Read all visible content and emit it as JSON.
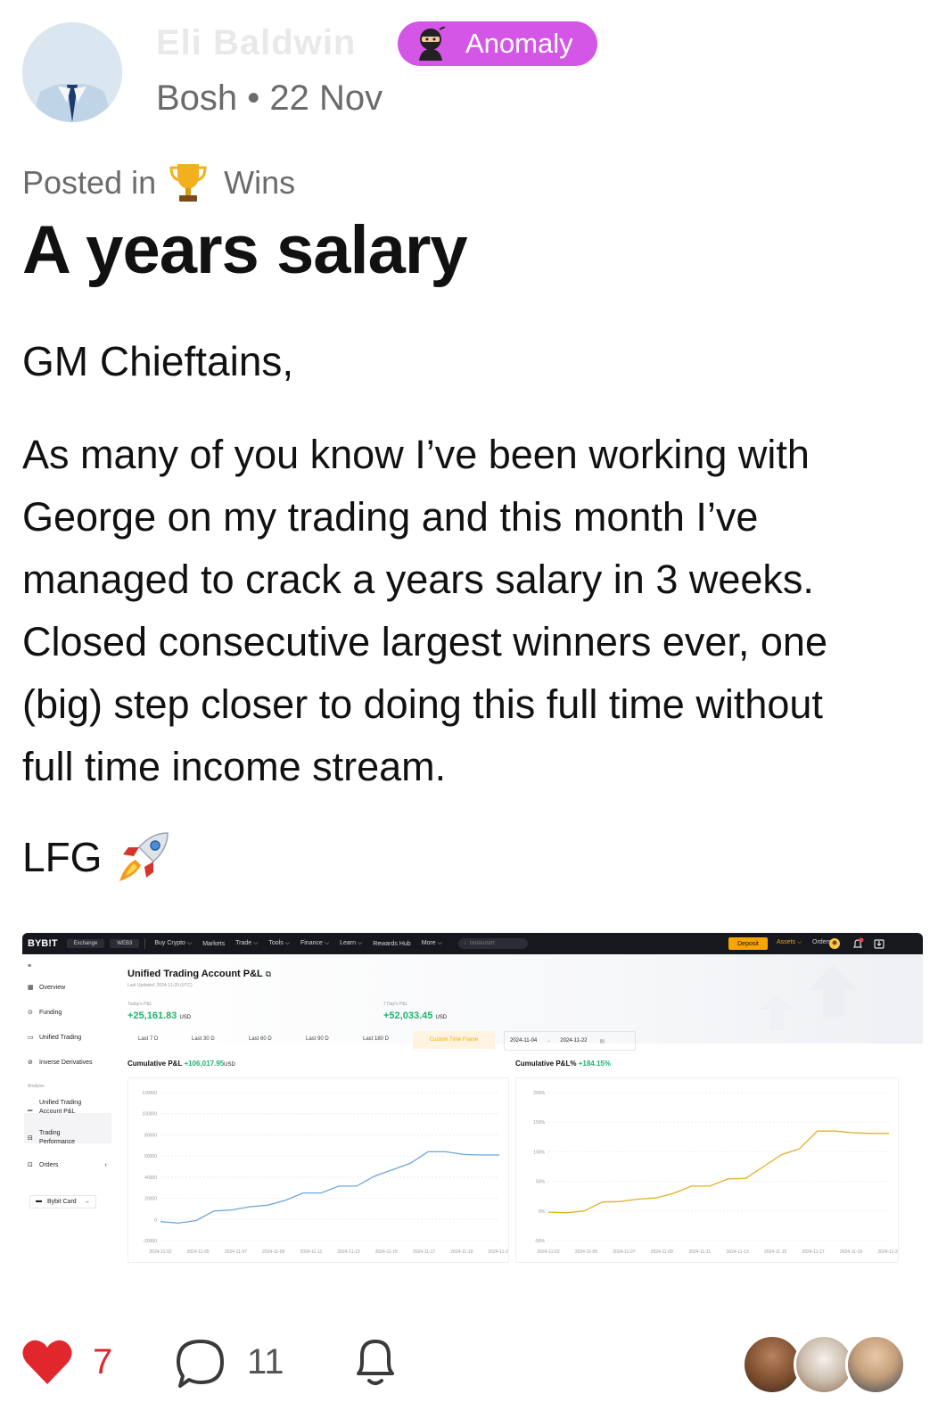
{
  "author": {
    "name": "Eli Baldwin",
    "badge_label": "Anomaly",
    "badge_icon": "ninja-icon",
    "meta": "Bosh • 22 Nov"
  },
  "post": {
    "posted_in_prefix": "Posted in",
    "category_icon": "trophy-icon",
    "category": "Wins",
    "title": "A years salary",
    "greeting": "GM Chieftains,",
    "body_lines": [
      "As many of you know I’ve been working with",
      "George on my trading and this month I’ve",
      "managed to crack a years salary in 3 weeks.",
      "Closed consecutive largest winners ever, one",
      "(big) step closer to doing this full time without",
      "full time income stream."
    ],
    "sign_off": "LFG",
    "sign_off_icon": "rocket-icon"
  },
  "screenshot": {
    "logo": "BYB!T",
    "nav_segments": [
      "Exchange",
      "WEB3"
    ],
    "nav_items": [
      "Buy Crypto ⌵",
      "Markets",
      "Trade ⌵",
      "Tools ⌵",
      "Finance ⌵",
      "Learn ⌵",
      "Rewards Hub",
      "More ⌵"
    ],
    "search_placeholder": "DOGEUSDT",
    "deposit_label": "Deposit",
    "assets_label": "Assets ⌵",
    "orders_label": "Orders ⌵",
    "sidebar": {
      "overview": "Overview",
      "funding": "Funding",
      "unified_trading": "Unified Trading",
      "inverse_derivatives": "Inverse Derivatives",
      "analysis": "Analysis",
      "account_pnl_line1": "Unified Trading",
      "account_pnl_line2": "Account P&L",
      "trading_perf_line1": "Trading",
      "trading_perf_line2": "Performance",
      "orders": "Orders",
      "card": "Bybit Card"
    },
    "page_title": "Unified Trading Account P&L",
    "last_updated": "Last Updated: 2024-11-20 (UTC)",
    "todays_pnl_label": "Today's P&L",
    "todays_pnl_value": "+25,161.83",
    "seven_day_pnl_label": "7 Day's P&L",
    "seven_day_pnl_value": "+52,033.45",
    "currency": "USD",
    "tabs": [
      "Last 7 D",
      "Last 30 D",
      "Last 60 D",
      "Last 90 D",
      "Last 180 D"
    ],
    "active_tab": "Custom Time Frame",
    "date_from": "2024-11-04",
    "date_to": "2024-11-22",
    "cum_pnl_label": "Cumulative P&L",
    "cum_pnl_value": "+106,017.95",
    "cum_pct_label": "Cumulative P&L%",
    "cum_pct_value": "+184.15%"
  },
  "chart_data": [
    {
      "type": "line",
      "title": "Cumulative P&L",
      "x": [
        "2024-11-02",
        "2024-11-03",
        "2024-11-04",
        "2024-11-05",
        "2024-11-06",
        "2024-11-07",
        "2024-11-08",
        "2024-11-09",
        "2024-11-10",
        "2024-11-11",
        "2024-11-12",
        "2024-11-13",
        "2024-11-14",
        "2024-11-15",
        "2024-11-16",
        "2024-11-17",
        "2024-11-18",
        "2024-11-19",
        "2024-11-20",
        "2024-11-21"
      ],
      "series": [
        {
          "color": "#6ea6dc",
          "values": [
            -2000,
            -3500,
            -1000,
            8000,
            9000,
            12000,
            13500,
            18000,
            25000,
            25000,
            31500,
            31500,
            41000,
            47000,
            53000,
            64000,
            64000,
            61500,
            61000,
            61000
          ]
        }
      ],
      "x_tick_labels": [
        "2024-11-02",
        "2024-11-05",
        "2024-11-07",
        "2024-11-09",
        "2024-11-11",
        "2024-11-13",
        "2024-11-15",
        "2024-11-17",
        "2024-11-19",
        "2024-11-21"
      ],
      "y_tick_labels": [
        "120000",
        "100000",
        "80000",
        "60000",
        "40000",
        "20000",
        "0",
        "-20000"
      ],
      "ylim": [
        -20000,
        120000
      ]
    },
    {
      "type": "line",
      "title": "Cumulative P&L%",
      "x": [
        "2024-11-02",
        "2024-11-03",
        "2024-11-04",
        "2024-11-05",
        "2024-11-06",
        "2024-11-07",
        "2024-11-08",
        "2024-11-09",
        "2024-11-10",
        "2024-11-11",
        "2024-11-12",
        "2024-11-13",
        "2024-11-14",
        "2024-11-15",
        "2024-11-16",
        "2024-11-17",
        "2024-11-18",
        "2024-11-19",
        "2024-11-20",
        "2024-11-21"
      ],
      "series": [
        {
          "color": "#e0b02a",
          "values": [
            -2,
            -3,
            0,
            15,
            16,
            20,
            22,
            30,
            42,
            42,
            54,
            55,
            75,
            95,
            105,
            135,
            135,
            132,
            131,
            131
          ]
        }
      ],
      "x_tick_labels": [
        "2024-11-02",
        "2024-11-05",
        "2024-11-07",
        "2024-11-09",
        "2024-11-11",
        "2024-11-13",
        "2024-11-15",
        "2024-11-17",
        "2024-11-19",
        "2024-11-21"
      ],
      "y_tick_labels": [
        "200%",
        "150%",
        "100%",
        "50%",
        "0%",
        "-50%"
      ],
      "ylim": [
        -50,
        200
      ]
    }
  ],
  "footer": {
    "likes": "7",
    "comments": "11",
    "heart_color": "#e0282c"
  }
}
